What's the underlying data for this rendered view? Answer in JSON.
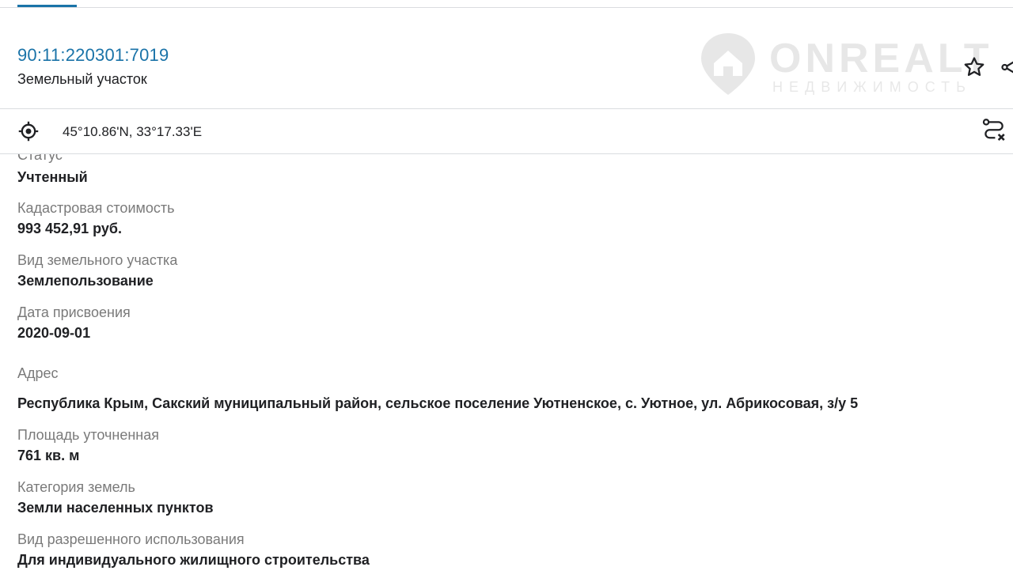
{
  "object": {
    "cadastral_number": "90:11:220301:7019",
    "type": "Земельный участок"
  },
  "watermark": {
    "brand": "ONREALT",
    "subtitle": "НЕДВИЖИМОСТЬ"
  },
  "actions": {
    "favorite_icon": "star-outline-icon",
    "share_icon": "share-icon"
  },
  "location": {
    "coordinates": "45°10.86'N, 33°17.33'E",
    "locate_icon": "crosshair-icon",
    "route_icon": "route-cancel-icon"
  },
  "details": {
    "status": {
      "label": "Статус",
      "value": "Учтенный"
    },
    "cadastral_value": {
      "label": "Кадастровая стоимость",
      "value": "993 452,91 руб."
    },
    "land_kind": {
      "label": "Вид земельного участка",
      "value": "Землепользование"
    },
    "assignment_date": {
      "label": "Дата присвоения",
      "value": "2020-09-01"
    },
    "address": {
      "label": "Адрес",
      "value": "Республика Крым, Сакский муниципальный район, сельское поселение Уютненское, с. Уютное, ул. Абрикосовая, з/у 5"
    },
    "area": {
      "label": "Площадь уточненная",
      "value": "761 кв. м"
    },
    "land_category": {
      "label": "Категория земель",
      "value": "Земли населенных пунктов"
    },
    "permitted_use": {
      "label": "Вид разрешенного использования",
      "value": "Для индивидуального жилищного строительства"
    }
  },
  "colors": {
    "accent": "#1a73a8",
    "label": "#7a7a7a",
    "value": "#202124",
    "divider": "#dadce0"
  }
}
